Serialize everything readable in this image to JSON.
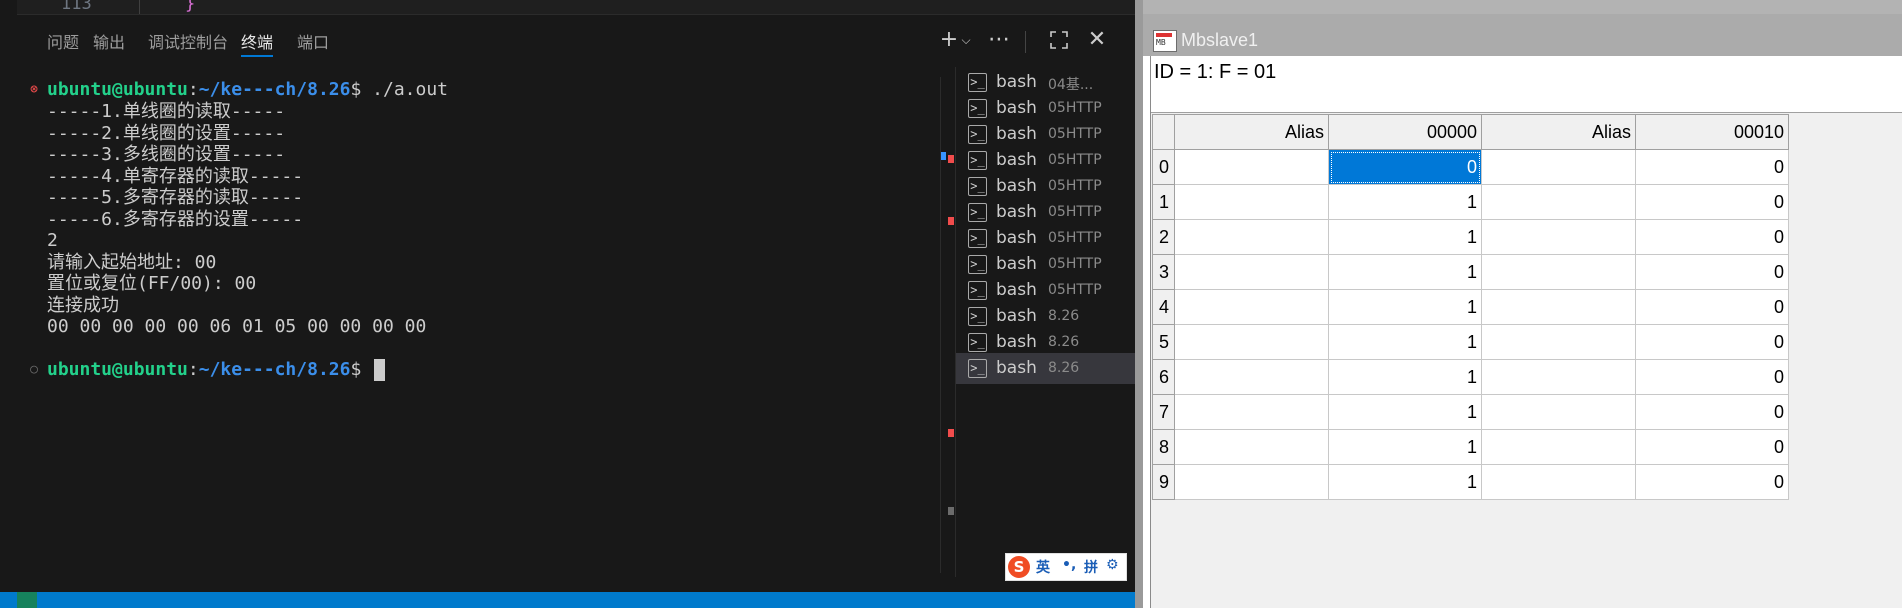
{
  "editor": {
    "line_number": "113",
    "code": "}"
  },
  "panel": {
    "tabs": [
      {
        "label": "问题",
        "active": false
      },
      {
        "label": "输出",
        "active": false
      },
      {
        "label": "调试控制台",
        "active": false
      },
      {
        "label": "终端",
        "active": true
      },
      {
        "label": "端口",
        "active": false
      }
    ],
    "icons": {
      "new_terminal": "plus-icon",
      "dropdown": "chevron-down-icon",
      "more": "ellipsis-icon",
      "maximize": "maximize-icon",
      "close": "close-icon"
    }
  },
  "terminal": {
    "prompt1": {
      "user": "ubuntu@ubuntu",
      "path": "~/ke---ch/8.26",
      "command": "./a.out",
      "status": "error"
    },
    "output": [
      "-----1.单线圈的读取-----",
      "-----2.单线圈的设置-----",
      "-----3.多线圈的设置-----",
      "-----4.单寄存器的读取-----",
      "-----5.多寄存器的读取-----",
      "-----6.多寄存器的设置-----",
      "2",
      "请输入起始地址: 00",
      "置位或复位(FF/00): 00",
      "连接成功",
      "00 00 00 00 00 06 01 05 00 00 00 00"
    ],
    "prompt2": {
      "user": "ubuntu@ubuntu",
      "path": "~/ke---ch/8.26",
      "command": ""
    }
  },
  "sessions": [
    {
      "name": "bash",
      "desc": "04基..."
    },
    {
      "name": "bash",
      "desc": "05HTTP"
    },
    {
      "name": "bash",
      "desc": "05HTTP"
    },
    {
      "name": "bash",
      "desc": "05HTTP"
    },
    {
      "name": "bash",
      "desc": "05HTTP"
    },
    {
      "name": "bash",
      "desc": "05HTTP"
    },
    {
      "name": "bash",
      "desc": "05HTTP"
    },
    {
      "name": "bash",
      "desc": "05HTTP"
    },
    {
      "name": "bash",
      "desc": "05HTTP"
    },
    {
      "name": "bash",
      "desc": "8.26"
    },
    {
      "name": "bash",
      "desc": "8.26"
    },
    {
      "name": "bash",
      "desc": "8.26",
      "active": true
    }
  ],
  "ime": {
    "logo": "S",
    "lang": "英",
    "punct": "•,",
    "mode": "拼",
    "settings": "gear-icon"
  },
  "mbslave": {
    "title": "Mbslave1",
    "header": "ID = 1: F = 01",
    "columns": [
      "Alias",
      "00000",
      "Alias",
      "00010"
    ],
    "rows": [
      {
        "index": "0",
        "alias1": "",
        "v1": "0",
        "alias2": "",
        "v2": "0",
        "selected": true
      },
      {
        "index": "1",
        "alias1": "",
        "v1": "1",
        "alias2": "",
        "v2": "0"
      },
      {
        "index": "2",
        "alias1": "",
        "v1": "1",
        "alias2": "",
        "v2": "0"
      },
      {
        "index": "3",
        "alias1": "",
        "v1": "1",
        "alias2": "",
        "v2": "0"
      },
      {
        "index": "4",
        "alias1": "",
        "v1": "1",
        "alias2": "",
        "v2": "0"
      },
      {
        "index": "5",
        "alias1": "",
        "v1": "1",
        "alias2": "",
        "v2": "0"
      },
      {
        "index": "6",
        "alias1": "",
        "v1": "1",
        "alias2": "",
        "v2": "0"
      },
      {
        "index": "7",
        "alias1": "",
        "v1": "1",
        "alias2": "",
        "v2": "0"
      },
      {
        "index": "8",
        "alias1": "",
        "v1": "1",
        "alias2": "",
        "v2": "0"
      },
      {
        "index": "9",
        "alias1": "",
        "v1": "1",
        "alias2": "",
        "v2": "0"
      }
    ]
  },
  "colors": {
    "accent": "#0078d4",
    "status_bar": "#007acc",
    "prompt_user": "#23d18b",
    "prompt_path": "#3b8eea",
    "grid_selection": "#0078d7"
  }
}
